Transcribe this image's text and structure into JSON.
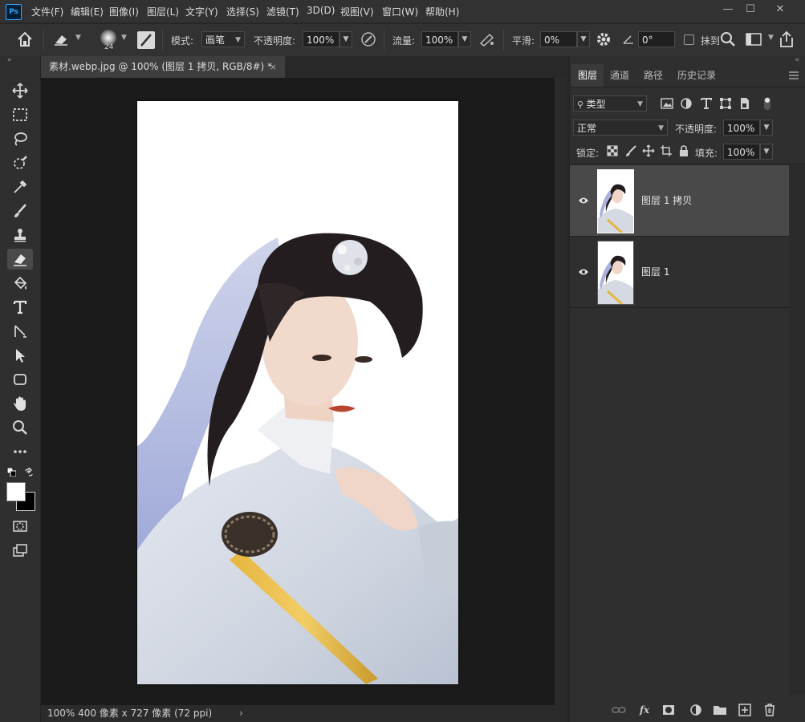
{
  "app": {
    "logo": "Ps"
  },
  "menu": [
    "文件(F)",
    "编辑(E)",
    "图像(I)",
    "图层(L)",
    "文字(Y)",
    "选择(S)",
    "滤镜(T)",
    "3D(D)",
    "视图(V)",
    "窗口(W)",
    "帮助(H)"
  ],
  "options": {
    "brush_size": "24",
    "mode_label": "模式:",
    "mode_value": "画笔",
    "opacity_label": "不透明度:",
    "opacity_value": "100%",
    "flow_label": "流量:",
    "flow_value": "100%",
    "smooth_label": "平滑:",
    "smooth_value": "0%",
    "angle_value": "0°",
    "erase_history_label": "抹到"
  },
  "document": {
    "tab_title": "素材.webp.jpg @ 100% (图层 1 拷贝, RGB/8#) *",
    "status": "100%     400 像素 x 727 像素 (72 ppi)"
  },
  "panel": {
    "tabs": [
      "图层",
      "通道",
      "路径",
      "历史记录"
    ],
    "filter_value": "类型",
    "blend_mode": "正常",
    "opacity_label": "不透明度:",
    "opacity_value": "100%",
    "lock_label": "锁定:",
    "fill_label": "填充:",
    "fill_value": "100%",
    "layers": [
      {
        "name": "图层 1 拷贝",
        "selected": true
      },
      {
        "name": "图层 1",
        "selected": false
      }
    ]
  },
  "colors": {
    "accent": "#31a8ff",
    "bg": "#282828",
    "panel": "#2f2f2f"
  }
}
